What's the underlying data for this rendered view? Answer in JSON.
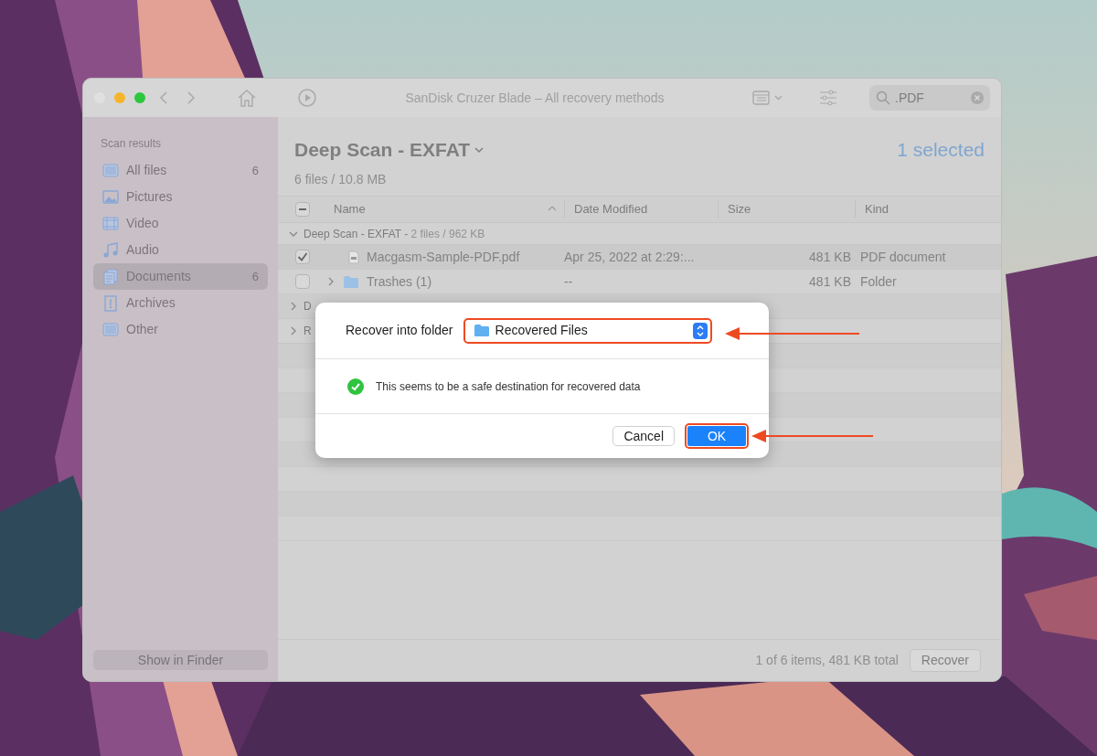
{
  "window": {
    "title": "SanDisk Cruzer Blade – All recovery methods",
    "search": {
      "value": ".PDF"
    }
  },
  "sidebar": {
    "heading": "Scan results",
    "items": [
      {
        "label": "All files",
        "count": "6",
        "selected": false
      },
      {
        "label": "Pictures",
        "selected": false
      },
      {
        "label": "Video",
        "selected": false
      },
      {
        "label": "Audio",
        "selected": false
      },
      {
        "label": "Documents",
        "count": "6",
        "selected": true
      },
      {
        "label": "Archives",
        "selected": false
      },
      {
        "label": "Other",
        "selected": false
      }
    ],
    "footer_button": "Show in Finder"
  },
  "header": {
    "title": "Deep Scan - EXFAT",
    "subtitle": "6 files / 10.8 MB",
    "selection": "1 selected"
  },
  "table": {
    "select_all_mixed": true,
    "columns": [
      "Name",
      "Date Modified",
      "Size",
      "Kind"
    ],
    "groups": [
      {
        "label": "Deep Scan - EXFAT - ",
        "detail": "2 files / 962 KB",
        "expanded": true,
        "rows": [
          {
            "kind": "file",
            "name": "Macgasm-Sample-PDF.pdf",
            "date": "Apr 25, 2022 at 2:29:...",
            "size": "481 KB",
            "file_kind": "PDF document",
            "checked": true
          },
          {
            "kind": "folder",
            "name": "Trashes (1)",
            "date": "--",
            "size": "481 KB",
            "file_kind": "Folder",
            "checked": false
          }
        ]
      },
      {
        "label": "D",
        "expanded": false
      },
      {
        "label": "R",
        "expanded": false
      }
    ]
  },
  "status_bar": {
    "summary": "1 of 6 items, 481 KB total",
    "button": "Recover"
  },
  "dialog": {
    "label": "Recover into folder",
    "folder": "Recovered Files",
    "message": "This seems to be a safe destination for recovered data",
    "buttons": [
      {
        "label": "Cancel",
        "primary": false
      },
      {
        "label": "OK",
        "primary": true
      }
    ]
  }
}
